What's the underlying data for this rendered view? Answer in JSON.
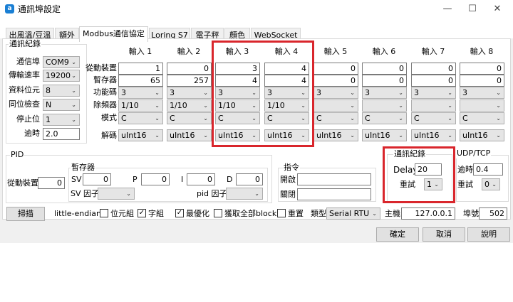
{
  "window": {
    "title": "通訊埠設定"
  },
  "tabs": [
    "出風溫/豆溫",
    "額外",
    "Modbus通信協定",
    "Loring S7",
    "電子秤",
    "顏色",
    "WebSocket"
  ],
  "comm": {
    "group": "通訊紀錄",
    "port_label": "通信埠",
    "port": "COM9",
    "baud_label": "傳輸速率",
    "baud": "19200",
    "bytesize_label": "資料位元",
    "bytesize": "8",
    "parity_label": "同位檢查",
    "parity": "N",
    "stopbits_label": "停止位",
    "stopbits": "1",
    "timeout_label": "逾時",
    "timeout": "2.0"
  },
  "inputs": {
    "row_labels": [
      "從動裝置",
      "暫存器",
      "功能碼",
      "除頻器",
      "模式",
      "解碼"
    ],
    "columns": [
      {
        "header": "輸入 1",
        "slave": "1",
        "register": "65",
        "fc": "3",
        "div": "1/10",
        "mode": "C",
        "decode": "uInt16"
      },
      {
        "header": "輸入 2",
        "slave": "0",
        "register": "257",
        "fc": "3",
        "div": "1/10",
        "mode": "C",
        "decode": "uInt16"
      },
      {
        "header": "輸入 3",
        "slave": "3",
        "register": "4",
        "fc": "3",
        "div": "1/10",
        "mode": "C",
        "decode": "uInt16"
      },
      {
        "header": "輸入 4",
        "slave": "4",
        "register": "4",
        "fc": "3",
        "div": "1/10",
        "mode": "C",
        "decode": "uInt16"
      },
      {
        "header": "輸入 5",
        "slave": "0",
        "register": "0",
        "fc": "3",
        "div": "",
        "mode": "C",
        "decode": "uInt16"
      },
      {
        "header": "輸入 6",
        "slave": "0",
        "register": "0",
        "fc": "3",
        "div": "",
        "mode": "C",
        "decode": "uInt16"
      },
      {
        "header": "輸入 7",
        "slave": "0",
        "register": "0",
        "fc": "3",
        "div": "",
        "mode": "C",
        "decode": "uInt16"
      },
      {
        "header": "輸入 8",
        "slave": "0",
        "register": "0",
        "fc": "3",
        "div": "",
        "mode": "C",
        "decode": "uInt16"
      }
    ]
  },
  "pid": {
    "group": "PID",
    "slave_label": "從動裝置",
    "slave": "0",
    "reg_group": "暫存器",
    "sv_label": "SV",
    "sv": "0",
    "p_label": "P",
    "p": "0",
    "i_label": "I",
    "i": "0",
    "d_label": "D",
    "d": "0",
    "svfactor_label": "SV 因子",
    "pidfactor_label": "pid 因子"
  },
  "cmd": {
    "group": "指令",
    "on_label": "開啟",
    "off_label": "關閉"
  },
  "log": {
    "group": "通訊紀錄",
    "delay_label": "Delay",
    "delay": "20",
    "retry_label": "重試",
    "retry": "1"
  },
  "udp": {
    "group": "UDP/TCP",
    "timeout_label": "逾時",
    "timeout": "0.4",
    "retry_label": "重試",
    "retry": "0"
  },
  "bottom": {
    "scan": "掃描",
    "endian": "little-endian",
    "bytes_label": "位元組",
    "words_label": "字組",
    "optimize_label": "最優化",
    "fetchall_label": "獲取全部block",
    "reset_label": "重置",
    "type_label": "類型",
    "type": "Serial RTU",
    "host_label": "主機",
    "host": "127.0.0.1",
    "port_label": "埠號",
    "port": "502"
  },
  "checks": {
    "bytes": false,
    "words": true,
    "optimize": true,
    "fetchall": false,
    "reset": false
  },
  "dialog": {
    "ok": "確定",
    "cancel": "取消",
    "help": "說明"
  },
  "colors": {
    "highlight": "#d9262c",
    "app_icon": "#1a7fd4"
  }
}
